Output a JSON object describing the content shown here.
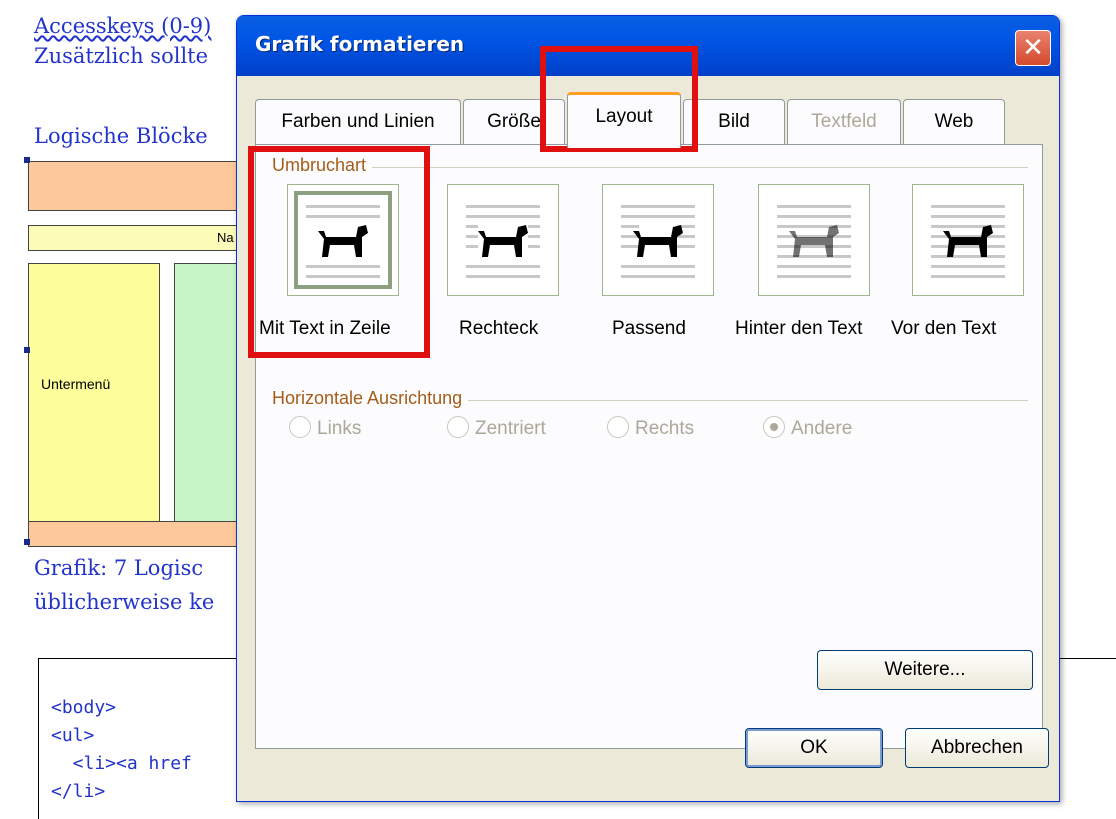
{
  "document": {
    "line1": "Accesskeys (0-9)",
    "line2": "Zusätzlich sollte",
    "line3": "Logische Blöcke",
    "diagram_nav": "Na",
    "diagram_submenu": "Untermenü",
    "caption1": "Grafik: 7 Logisc",
    "caption2": "üblicherweise ke",
    "code": [
      "<body>",
      "<ul>",
      "  <li><a href",
      "</li>"
    ]
  },
  "dialog": {
    "title": "Grafik formatieren",
    "close_symbol": "✕",
    "tabs": [
      {
        "label": "Farben und Linien",
        "state": "normal"
      },
      {
        "label": "Größe",
        "state": "normal"
      },
      {
        "label": "Layout",
        "state": "active"
      },
      {
        "label": "Bild",
        "state": "normal"
      },
      {
        "label": "Textfeld",
        "state": "disabled"
      },
      {
        "label": "Web",
        "state": "normal"
      }
    ],
    "wrap_group_label": "Umbruchart",
    "wrap_options": [
      {
        "label": "Mit Text in Zeile",
        "mnemonic": "M",
        "selected": true,
        "icon": "inline-dog-icon"
      },
      {
        "label": "Rechteck",
        "mnemonic": "k",
        "selected": false,
        "icon": "square-dog-icon"
      },
      {
        "label": "Passend",
        "mnemonic": "P",
        "selected": false,
        "icon": "tight-dog-icon"
      },
      {
        "label": "Hinter den Text",
        "mnemonic": "t",
        "selected": false,
        "icon": "behind-text-dog-icon"
      },
      {
        "label": "Vor den Text",
        "mnemonic": "V",
        "selected": false,
        "icon": "in-front-dog-icon"
      }
    ],
    "align_group_label": "Horizontale Ausrichtung",
    "align_options": [
      {
        "label": "Links",
        "checked": false
      },
      {
        "label": "Zentriert",
        "checked": false
      },
      {
        "label": "Rechts",
        "checked": false
      },
      {
        "label": "Andere",
        "checked": true
      }
    ],
    "more_button": "Weitere...",
    "ok_button": "OK",
    "cancel_button": "Abbrechen"
  },
  "colors": {
    "highlight": "#e01010",
    "xp_title": "#0055e5",
    "tab_accent": "#ff9c1e"
  }
}
